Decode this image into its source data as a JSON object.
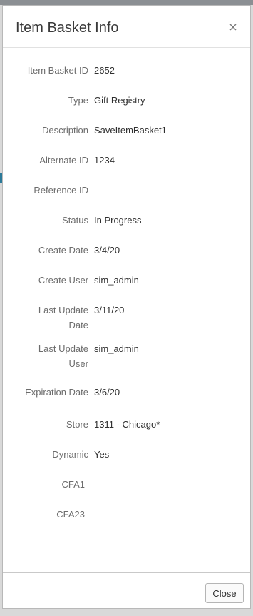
{
  "dialog": {
    "title": "Item Basket Info",
    "close_button_label": "Close"
  },
  "fields": [
    {
      "label": "Item Basket ID",
      "value": "2652"
    },
    {
      "label": "Type",
      "value": "Gift Registry"
    },
    {
      "label": "Description",
      "value": "SaveItemBasket1"
    },
    {
      "label": "Alternate ID",
      "value": "1234"
    },
    {
      "label": "Reference ID",
      "value": ""
    },
    {
      "label": "Status",
      "value": "In Progress"
    },
    {
      "label": "Create Date",
      "value": "3/4/20"
    },
    {
      "label": "Create User",
      "value": "sim_admin"
    },
    {
      "label": "Last Update Date",
      "label_line1": "Last Update",
      "label_line2": "Date",
      "value": "3/11/20"
    },
    {
      "label": "Last Update User",
      "label_line1": "Last Update",
      "label_line2": "User",
      "value": "sim_admin"
    },
    {
      "label": "Expiration Date",
      "value": "3/6/20"
    },
    {
      "label": "Store",
      "value": "1311 - Chicago*"
    },
    {
      "label": "Dynamic",
      "value": "Yes"
    },
    {
      "label": "CFA1",
      "value": ""
    },
    {
      "label": "CFA23",
      "value": ""
    }
  ]
}
